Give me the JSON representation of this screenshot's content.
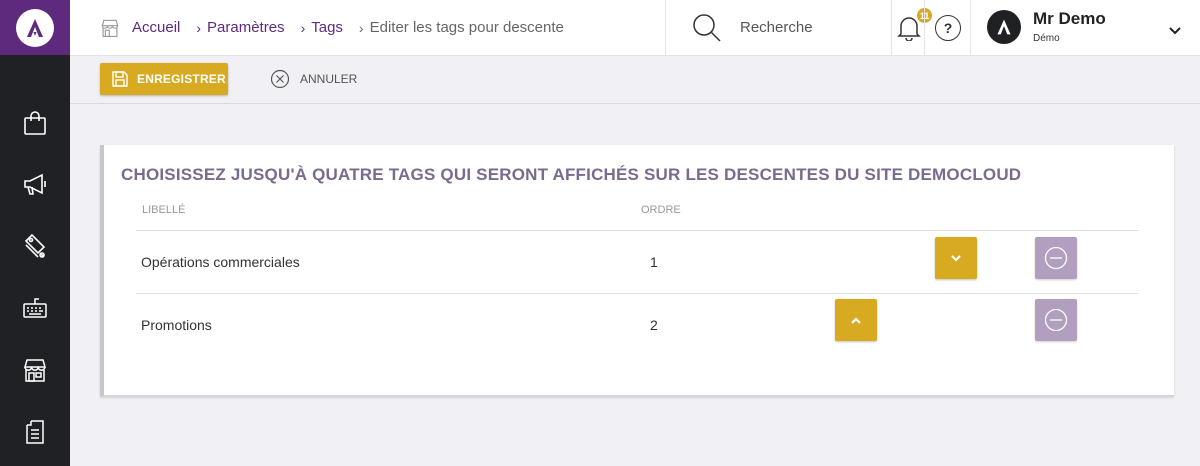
{
  "breadcrumb": [
    "Accueil",
    "Paramètres",
    "Tags",
    "Editer les tags pour descente"
  ],
  "search": {
    "placeholder": "Recherche"
  },
  "notifications": {
    "count": "11"
  },
  "help": {
    "label": "?"
  },
  "user": {
    "name": "Mr Demo",
    "role": "Démo"
  },
  "actions": {
    "save_label": "ENREGISTRER",
    "cancel_label": "ANNULER"
  },
  "card": {
    "title": "CHOISISSEZ JUSQU'À QUATRE TAGS QUI SERONT AFFICHÉS SUR LES DESCENTES DU SITE DEMOCLOUD",
    "columns": {
      "label": "LIBELLÉ",
      "order": "ORDRE"
    },
    "rows": [
      {
        "label": "Opérations commerciales",
        "order": "1"
      },
      {
        "label": "Promotions",
        "order": "2"
      }
    ]
  },
  "colors": {
    "brand": "#5d2a7e",
    "accent": "#d7aa22",
    "remove": "#b29fc0",
    "sidebar": "#1f2124"
  },
  "icons": {
    "sidebar": [
      "shopping-bag-icon",
      "megaphone-icon",
      "tags-icon",
      "keyboard-icon",
      "store-icon",
      "document-icon"
    ]
  }
}
